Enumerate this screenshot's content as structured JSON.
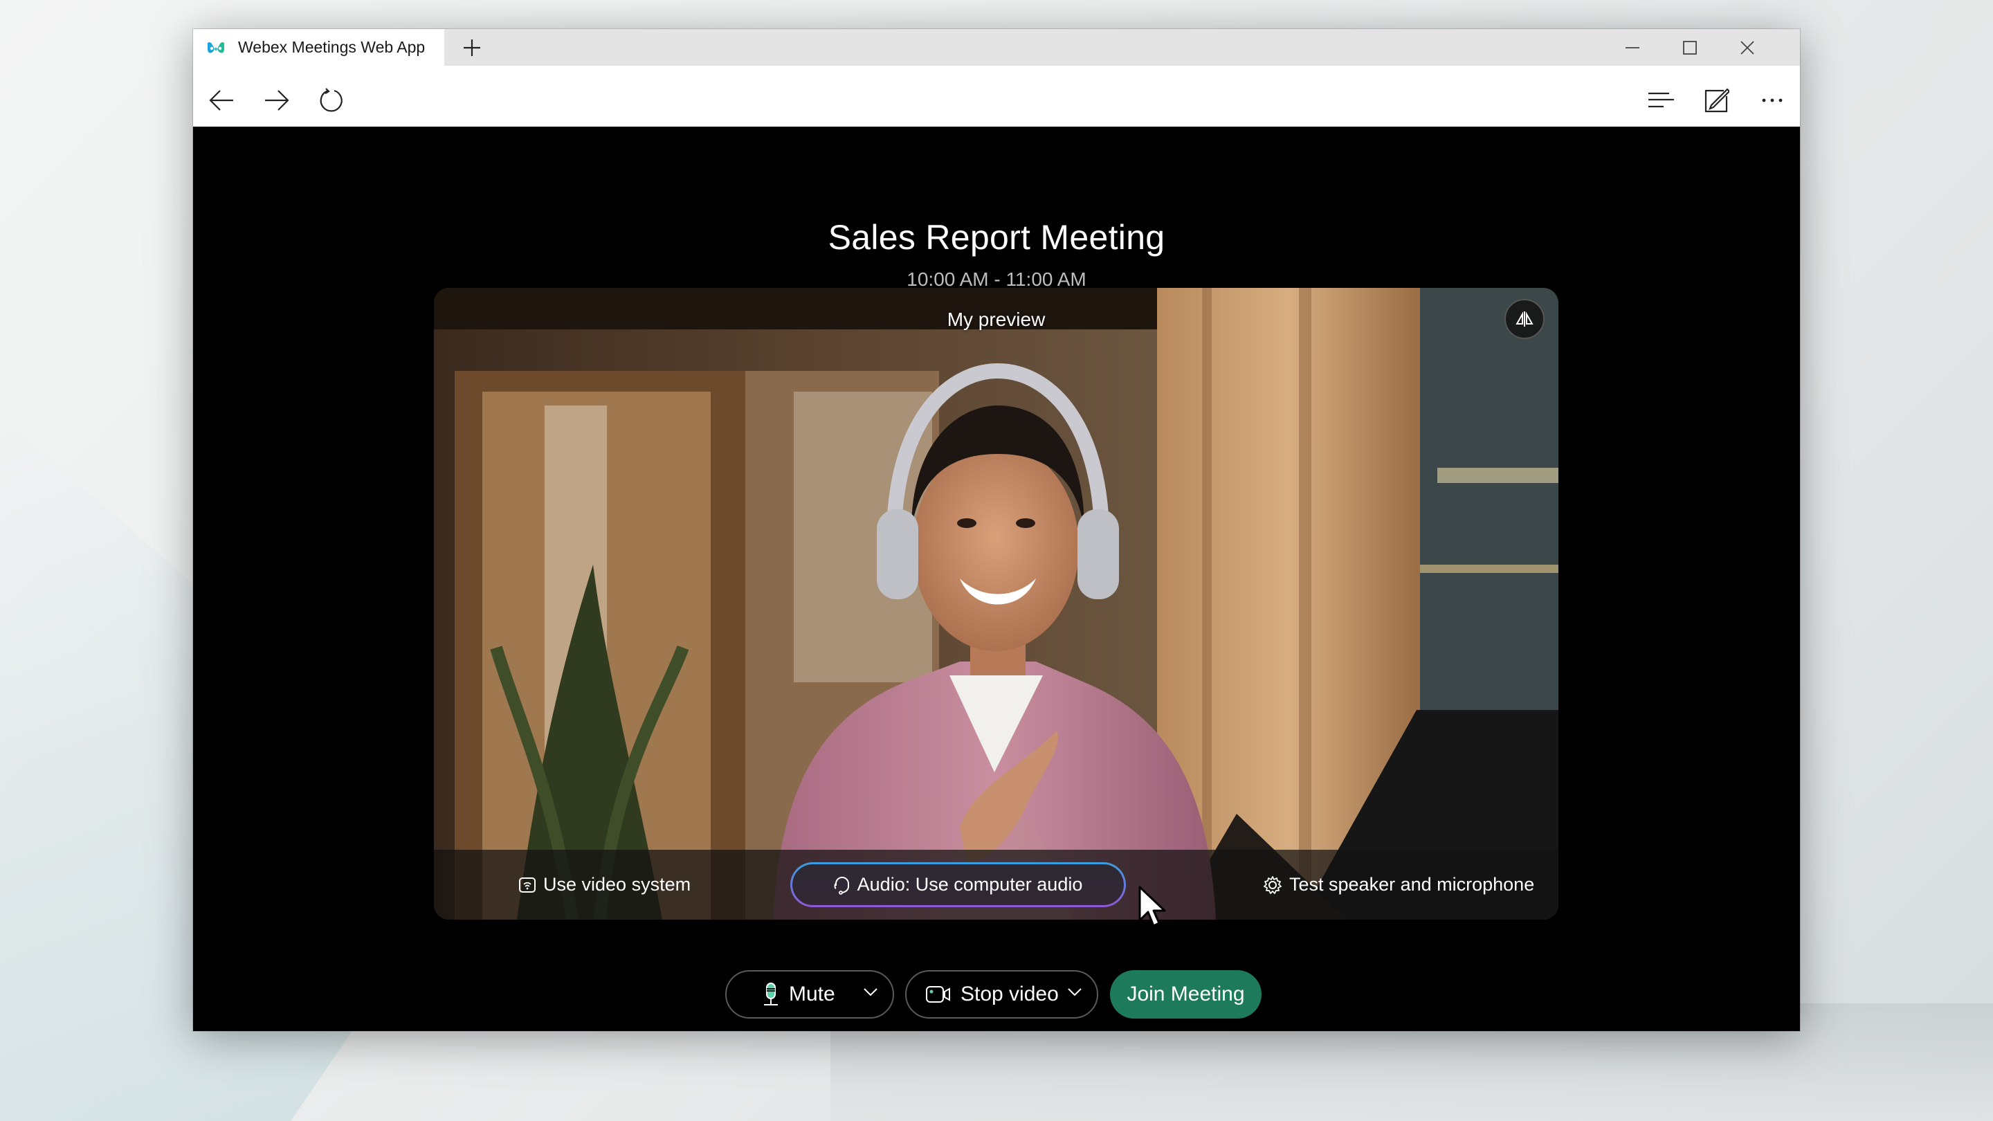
{
  "browser": {
    "tab_title": "Webex Meetings Web App",
    "new_tab_icon": "plus-icon",
    "window_controls": [
      "minimize-icon",
      "maximize-icon",
      "close-icon"
    ],
    "nav_icons": [
      "back-arrow-icon",
      "forward-arrow-icon",
      "refresh-icon"
    ],
    "toolbar_icons": [
      "reading-list-icon",
      "annotate-icon",
      "more-icon"
    ]
  },
  "meeting": {
    "title": "Sales Report Meeting",
    "time": "10:00 AM - 11:00 AM"
  },
  "preview": {
    "label": "My preview",
    "mirror_icon": "mirror-icon",
    "options": {
      "video_system": "Use video system",
      "audio": "Audio: Use computer audio",
      "test": "Test speaker and microphone"
    }
  },
  "controls": {
    "mute": "Mute",
    "stop_video": "Stop video",
    "join": "Join Meeting"
  },
  "colors": {
    "join_green": "#1d7a5a",
    "accent_teal": "#5ed1ab",
    "audio_border_top": "#3a9de0",
    "audio_border_bottom": "#8f58d8"
  }
}
